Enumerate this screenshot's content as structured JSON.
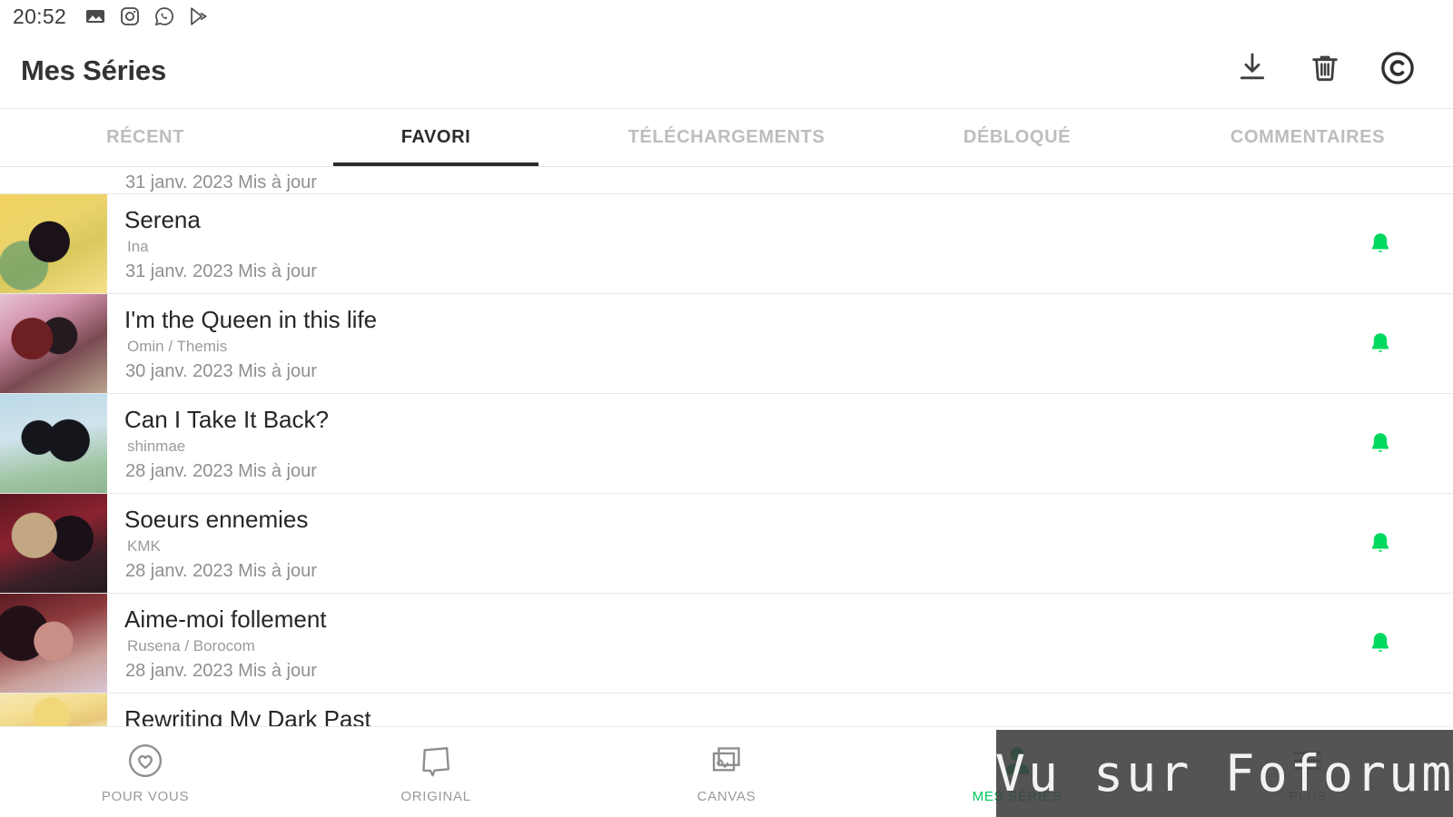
{
  "statusbar": {
    "clock": "20:52",
    "icons": [
      "image-icon",
      "instagram-icon",
      "whatsapp-icon",
      "play-store-icon"
    ]
  },
  "appbar": {
    "title": "Mes Séries",
    "actions": [
      {
        "name": "download-icon",
        "label": "Télécharger"
      },
      {
        "name": "trash-icon",
        "label": "Supprimer"
      },
      {
        "name": "copyright-icon",
        "label": "Coin"
      }
    ]
  },
  "tabs": {
    "active_index": 1,
    "items": [
      {
        "label": "RÉCENT"
      },
      {
        "label": "FAVORI"
      },
      {
        "label": "TÉLÉCHARGEMENTS"
      },
      {
        "label": "DÉBLOQUÉ"
      },
      {
        "label": "COMMENTAIRES"
      }
    ]
  },
  "list": {
    "clipped_top": {
      "updated": "31 janv. 2023 Mis à jour"
    },
    "items": [
      {
        "title": "Serena",
        "author": "Ina",
        "updated": "31 janv. 2023 Mis à jour",
        "notify": "bell-icon"
      },
      {
        "title": "I'm the Queen in this life",
        "author": "Omin / Themis",
        "updated": "30 janv. 2023 Mis à jour",
        "notify": "bell-icon"
      },
      {
        "title": "Can I Take It Back?",
        "author": "shinmae",
        "updated": "28 janv. 2023 Mis à jour",
        "notify": "bell-icon"
      },
      {
        "title": "Soeurs ennemies",
        "author": "KMK",
        "updated": "28 janv. 2023 Mis à jour",
        "notify": "bell-icon"
      },
      {
        "title": "Aime-moi follement",
        "author": "Rusena / Borocom",
        "updated": "28 janv. 2023 Mis à jour",
        "notify": "bell-icon"
      }
    ],
    "clipped_bottom": {
      "title": "Rewriting My Dark Past"
    }
  },
  "bottomnav": {
    "active_index": 3,
    "items": [
      {
        "label": "POUR VOUS",
        "icon": "heart-circle-icon"
      },
      {
        "label": "ORIGINAL",
        "icon": "original-flag-icon"
      },
      {
        "label": "CANVAS",
        "icon": "canvas-cards-icon"
      },
      {
        "label": "MES SÉRIES",
        "icon": "person-icon"
      },
      {
        "label": "PLUS",
        "icon": "more-icon"
      }
    ]
  },
  "watermark": {
    "text": "Vu sur Foforum"
  },
  "colors": {
    "accent_green": "#00c75a",
    "bell_green": "#00d85f",
    "tab_active": "#2b2b2b",
    "tab_inactive": "#bdbdbd",
    "title_text": "#333333",
    "watermark_bg": "#3c3c3c"
  }
}
